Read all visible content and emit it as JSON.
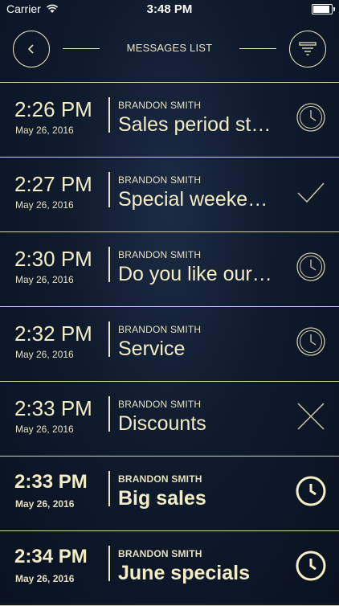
{
  "statusbar": {
    "carrier": "Carrier",
    "time": "3:48 PM",
    "battery_level": 0.9
  },
  "header": {
    "title": "MESSAGES LIST",
    "back_icon": "chevron-left-icon",
    "filter_icon": "filter-icon"
  },
  "colors": {
    "accent": "#f3ecc4",
    "background": "#0f1a2c"
  },
  "messages": [
    {
      "time": "2:26 PM",
      "date": "May 26, 2016",
      "sender": "BRANDON SMITH",
      "subject": "Sales period sta…",
      "status": "clock",
      "bold": false
    },
    {
      "time": "2:27 PM",
      "date": "May 26, 2016",
      "sender": "BRANDON SMITH",
      "subject": "Special weeken…",
      "status": "check",
      "bold": false
    },
    {
      "time": "2:30 PM",
      "date": "May 26, 2016",
      "sender": "BRANDON SMITH",
      "subject": "Do you like our…",
      "status": "clock",
      "bold": false
    },
    {
      "time": "2:32 PM",
      "date": "May 26, 2016",
      "sender": "BRANDON SMITH",
      "subject": "Service",
      "status": "clock",
      "bold": false
    },
    {
      "time": "2:33 PM",
      "date": "May 26, 2016",
      "sender": "BRANDON SMITH",
      "subject": "Discounts",
      "status": "cross",
      "bold": false
    },
    {
      "time": "2:33 PM",
      "date": "May 26, 2016",
      "sender": "BRANDON SMITH",
      "subject": "Big sales",
      "status": "clock",
      "bold": true
    },
    {
      "time": "2:34 PM",
      "date": "May 26, 2016",
      "sender": "BRANDON SMITH",
      "subject": "June specials",
      "status": "clock",
      "bold": true
    }
  ]
}
